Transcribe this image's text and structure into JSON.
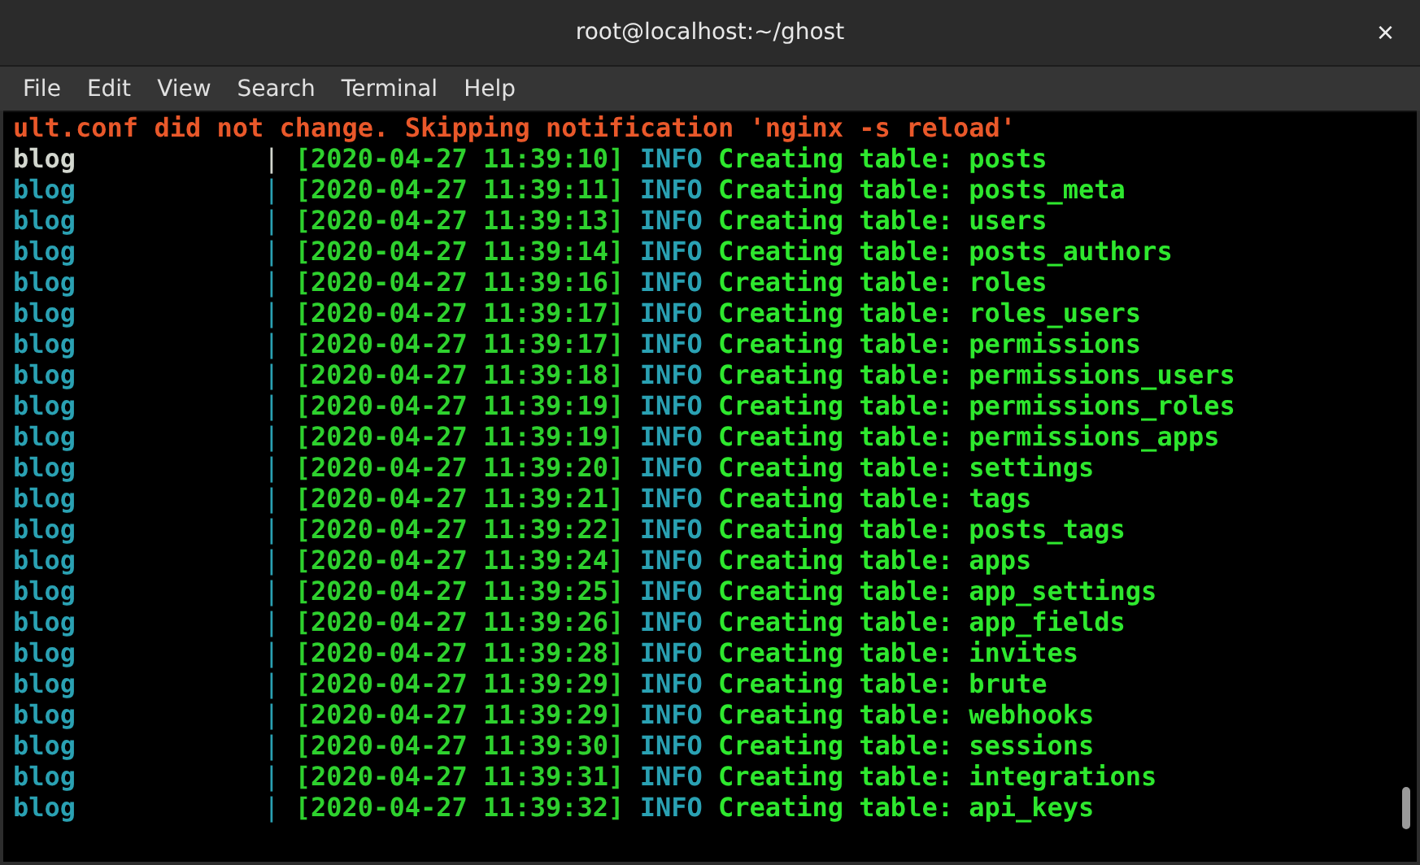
{
  "window": {
    "title": "root@localhost:~/ghost",
    "close": "×"
  },
  "menu": [
    "File",
    "Edit",
    "View",
    "Search",
    "Terminal",
    "Help"
  ],
  "terminal": {
    "warning": "ult.conf did not change. Skipping notification 'nginx -s reload'",
    "rows": [
      {
        "service": "blog",
        "separator": "|",
        "color": "#d3d7cf",
        "timestamp": "[2020-04-27 11:39:10]",
        "level": "INFO",
        "message": "Creating table: posts"
      },
      {
        "service": "blog",
        "separator": "|",
        "color": "#2aa1b3",
        "timestamp": "[2020-04-27 11:39:11]",
        "level": "INFO",
        "message": "Creating table: posts_meta"
      },
      {
        "service": "blog",
        "separator": "|",
        "color": "#2aa1b3",
        "timestamp": "[2020-04-27 11:39:13]",
        "level": "INFO",
        "message": "Creating table: users"
      },
      {
        "service": "blog",
        "separator": "|",
        "color": "#2aa1b3",
        "timestamp": "[2020-04-27 11:39:14]",
        "level": "INFO",
        "message": "Creating table: posts_authors"
      },
      {
        "service": "blog",
        "separator": "|",
        "color": "#2aa1b3",
        "timestamp": "[2020-04-27 11:39:16]",
        "level": "INFO",
        "message": "Creating table: roles"
      },
      {
        "service": "blog",
        "separator": "|",
        "color": "#2aa1b3",
        "timestamp": "[2020-04-27 11:39:17]",
        "level": "INFO",
        "message": "Creating table: roles_users"
      },
      {
        "service": "blog",
        "separator": "|",
        "color": "#2aa1b3",
        "timestamp": "[2020-04-27 11:39:17]",
        "level": "INFO",
        "message": "Creating table: permissions"
      },
      {
        "service": "blog",
        "separator": "|",
        "color": "#2aa1b3",
        "timestamp": "[2020-04-27 11:39:18]",
        "level": "INFO",
        "message": "Creating table: permissions_users"
      },
      {
        "service": "blog",
        "separator": "|",
        "color": "#2aa1b3",
        "timestamp": "[2020-04-27 11:39:19]",
        "level": "INFO",
        "message": "Creating table: permissions_roles"
      },
      {
        "service": "blog",
        "separator": "|",
        "color": "#2aa1b3",
        "timestamp": "[2020-04-27 11:39:19]",
        "level": "INFO",
        "message": "Creating table: permissions_apps"
      },
      {
        "service": "blog",
        "separator": "|",
        "color": "#2aa1b3",
        "timestamp": "[2020-04-27 11:39:20]",
        "level": "INFO",
        "message": "Creating table: settings"
      },
      {
        "service": "blog",
        "separator": "|",
        "color": "#2aa1b3",
        "timestamp": "[2020-04-27 11:39:21]",
        "level": "INFO",
        "message": "Creating table: tags"
      },
      {
        "service": "blog",
        "separator": "|",
        "color": "#2aa1b3",
        "timestamp": "[2020-04-27 11:39:22]",
        "level": "INFO",
        "message": "Creating table: posts_tags"
      },
      {
        "service": "blog",
        "separator": "|",
        "color": "#2aa1b3",
        "timestamp": "[2020-04-27 11:39:24]",
        "level": "INFO",
        "message": "Creating table: apps"
      },
      {
        "service": "blog",
        "separator": "|",
        "color": "#2aa1b3",
        "timestamp": "[2020-04-27 11:39:25]",
        "level": "INFO",
        "message": "Creating table: app_settings"
      },
      {
        "service": "blog",
        "separator": "|",
        "color": "#2aa1b3",
        "timestamp": "[2020-04-27 11:39:26]",
        "level": "INFO",
        "message": "Creating table: app_fields"
      },
      {
        "service": "blog",
        "separator": "|",
        "color": "#2aa1b3",
        "timestamp": "[2020-04-27 11:39:28]",
        "level": "INFO",
        "message": "Creating table: invites"
      },
      {
        "service": "blog",
        "separator": "|",
        "color": "#2aa1b3",
        "timestamp": "[2020-04-27 11:39:29]",
        "level": "INFO",
        "message": "Creating table: brute"
      },
      {
        "service": "blog",
        "separator": "|",
        "color": "#2aa1b3",
        "timestamp": "[2020-04-27 11:39:29]",
        "level": "INFO",
        "message": "Creating table: webhooks"
      },
      {
        "service": "blog",
        "separator": "|",
        "color": "#2aa1b3",
        "timestamp": "[2020-04-27 11:39:30]",
        "level": "INFO",
        "message": "Creating table: sessions"
      },
      {
        "service": "blog",
        "separator": "|",
        "color": "#2aa1b3",
        "timestamp": "[2020-04-27 11:39:31]",
        "level": "INFO",
        "message": "Creating table: integrations"
      },
      {
        "service": "blog",
        "separator": "|",
        "color": "#2aa1b3",
        "timestamp": "[2020-04-27 11:39:32]",
        "level": "INFO",
        "message": "Creating table: api_keys"
      }
    ]
  }
}
